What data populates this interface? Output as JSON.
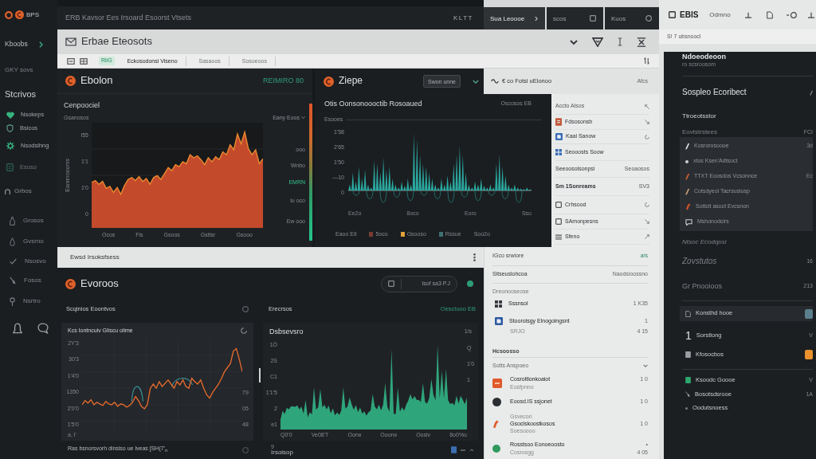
{
  "sidebar": {
    "brand": "BPS",
    "account": "Kboobs",
    "workspace": "GKY sovs",
    "section": "Stcrivos",
    "items": [
      {
        "label": "Nsokeps",
        "disabled": false
      },
      {
        "label": "Bsicos",
        "disabled": false
      },
      {
        "label": "Nsodsihng",
        "disabled": false
      },
      {
        "label": "Esoso",
        "disabled": true
      }
    ],
    "group": "Grbos",
    "links": [
      "Grosos",
      "Gvsrno",
      "Nsosvo",
      "Fosos",
      "Nsrtro"
    ]
  },
  "title_bar": {
    "title": "ERB Kavsor Ees Irsoard Esoorst Vtsets",
    "status": "KLTT"
  },
  "tabs": [
    {
      "label": "Sua Leoooe",
      "selected": true
    },
    {
      "label": "scos",
      "selected": false
    },
    {
      "label": "Kuos",
      "selected": false
    }
  ],
  "side_panel": {
    "title": "EBIS",
    "subtitle": "Odmno",
    "path": "S! 7 ubsnoocl",
    "heading": "Ndoeodeoon",
    "caption": "ro scsroosom",
    "section": "Sospleo Ecoribect",
    "group_title": "Ttroeotsstor",
    "group_label": "Eovtstrstees",
    "group_note": "FCI",
    "group_items": [
      {
        "label": "Kosrorosoooe",
        "value": "3d"
      },
      {
        "label": "xtos Ksen'Adtsoct"
      },
      {
        "label": "TTXT Eoosdos Vcsonnce",
        "value": "Ec"
      },
      {
        "label": "Cotsdyeol Tacrsusiusp"
      },
      {
        "label": "Sottcit asoct Evcsnon"
      },
      {
        "label": "Mshonodcirs"
      }
    ],
    "notes": [
      {
        "label": "Ntsoc Ecodqosi"
      },
      {
        "label": "Zovstutos",
        "value": "16"
      },
      {
        "label": "Gr Pnooioos",
        "value": "213"
      }
    ],
    "tasks": [
      {
        "label": "Konsthd hooe",
        "selected": true,
        "color": "#5b7f8c"
      },
      {
        "number": "1",
        "label": "Sorstlong",
        "value": "V",
        "selected": false
      },
      {
        "label": "Kfosocbos",
        "selected": false,
        "color": "#e8912d"
      },
      {
        "label": "Ksoodc Goooe",
        "value": "V",
        "selected": false
      },
      {
        "label": "Bosotsdsrooe",
        "value": "1A",
        "selected": false
      },
      {
        "label": "Oodutsnoess",
        "selected": false
      }
    ]
  },
  "header": {
    "title": "Erbae Eteosots"
  },
  "toolbar": {
    "tag": "RiiG",
    "tabs": [
      {
        "label": "Eckosodonsi Viseno",
        "selected": true
      },
      {
        "label": "Sasaoos",
        "selected": false
      },
      {
        "label": "Sosoeoos",
        "selected": false
      }
    ]
  },
  "area_widget": {
    "title": "Ebolon",
    "badge": "REIMIRO 80",
    "subtitle": "Cenpoociel",
    "axis_title": "Gsanosos",
    "y_title": "Eanmrooorss",
    "y_labels": [
      "l55",
      "1'1",
      "1'0",
      "0"
    ],
    "x_labels": [
      "Ocos",
      "Fis",
      "Gsoos",
      "Gsttsr",
      "Gsooo"
    ],
    "legend_select": "Eany Eoos",
    "legend": [
      {
        "label": "ooo",
        "selected": false
      },
      {
        "label": "Wnbo",
        "selected": false
      },
      {
        "label": "EMRN",
        "selected": true
      },
      {
        "label": "lu oco",
        "selected": false
      },
      {
        "label": "Ew ooo",
        "selected": false
      }
    ]
  },
  "wave_widget": {
    "title": "Ziepe",
    "dropdown": "Swon unne",
    "chart_title": "Otis Oonsonoooctib Rosoaued",
    "chart_note": "Oscosos EB",
    "axis_title": "Esooes",
    "y_labels": [
      "1'58",
      "2'65",
      "1'50",
      "—10",
      "0"
    ],
    "x_labels": [
      "Ee2o",
      "8oco",
      "Eoro",
      "Sso"
    ],
    "legend": [
      {
        "label": "Eaoo Eit"
      },
      {
        "label": "5oco",
        "color": "#7a3b32"
      },
      {
        "label": "Gsooso",
        "color": "#e0a23a"
      },
      {
        "label": "Rssue",
        "color": "#3f6f73"
      },
      {
        "label": "Soo2o"
      }
    ]
  },
  "list_panel": {
    "title": "€ co Fotsi uElonoo",
    "note": "Afcs",
    "rows": [
      {
        "label": "Accto Alsos"
      },
      {
        "label": "Fdsosonsb"
      },
      {
        "label": "Kaai Sanow"
      },
      {
        "label": "Seooosts Soow"
      },
      {
        "label": "Seeoosolsonpsi",
        "value": "Seoaosos"
      },
      {
        "label": "Sm 1Sonreams",
        "value": "SV3"
      },
      {
        "label": "Crhsood"
      },
      {
        "label": "SAmonpesns"
      },
      {
        "label": "Sfeno"
      }
    ]
  },
  "band": {
    "title": "Ewsd Irsoksfsess"
  },
  "detail_panel": {
    "title": "IGco srwiore",
    "title_note": "a/s",
    "summary": "Sitseuslohcoa",
    "summary_value": "Naodsioossno",
    "section": "Dreonooseose",
    "items": [
      {
        "label": "Sssnsol",
        "value": "1 K35"
      },
      {
        "label": "Stoorolsgy Elnogoingsnt",
        "value": "1",
        "sub": "SRJO",
        "sub_value": "4 15"
      }
    ],
    "section_2": "Hcsoosso",
    "filter": "Sotts Anspoeo",
    "entries": [
      {
        "label": "Cosroltlonkoaiot",
        "value": "1 0",
        "sub": "Eosfpnno"
      },
      {
        "label": "Eoosd.IS ssjonet",
        "value": "1 0"
      },
      {
        "pre": "Gsvecon",
        "label": "Gsoclskoostkosos",
        "value": "1 0",
        "sub": "Soesoooo"
      },
      {
        "label": "Rosstsoo Eonoeoosto",
        "value": "•",
        "sub": "Cosrosgg",
        "sub_value": "4 05"
      }
    ]
  },
  "events_panel": {
    "title": "Evoroos",
    "search_value": "lsof sa3 P.J",
    "left": {
      "title": "Scqinios Eoontvos",
      "chart_title": "Kcs Iontncuiv Gliscu olime",
      "y_labels": [
        "2Y'3",
        "30'3",
        "1'4'0",
        "1350",
        "2'0'0",
        "1'5'0"
      ],
      "x_note": "a. l'",
      "right_labels": [
        "79",
        "05",
        "48"
      ],
      "footer": "Ras bsnorsvorh dinsiso ue lveas [SH(7'$_{n}$"
    },
    "right": {
      "title": "Erecrsos",
      "note": "Oesctuoo EB",
      "chart_title": "Dsbsevsro",
      "chart_note": "1/s",
      "y_labels": [
        "1Ö",
        "2S",
        "C1",
        "1'1'5",
        "2",
        "e1"
      ],
      "right_labels": [
        "Q",
        "1'0",
        "1"
      ],
      "x_labels": [
        "Q0'0",
        "Ve08'T",
        "Oorw",
        "Ooorw",
        "Oosiv",
        "8o0%o"
      ],
      "footer_note": "9",
      "footer": "Irsoisop"
    }
  }
}
